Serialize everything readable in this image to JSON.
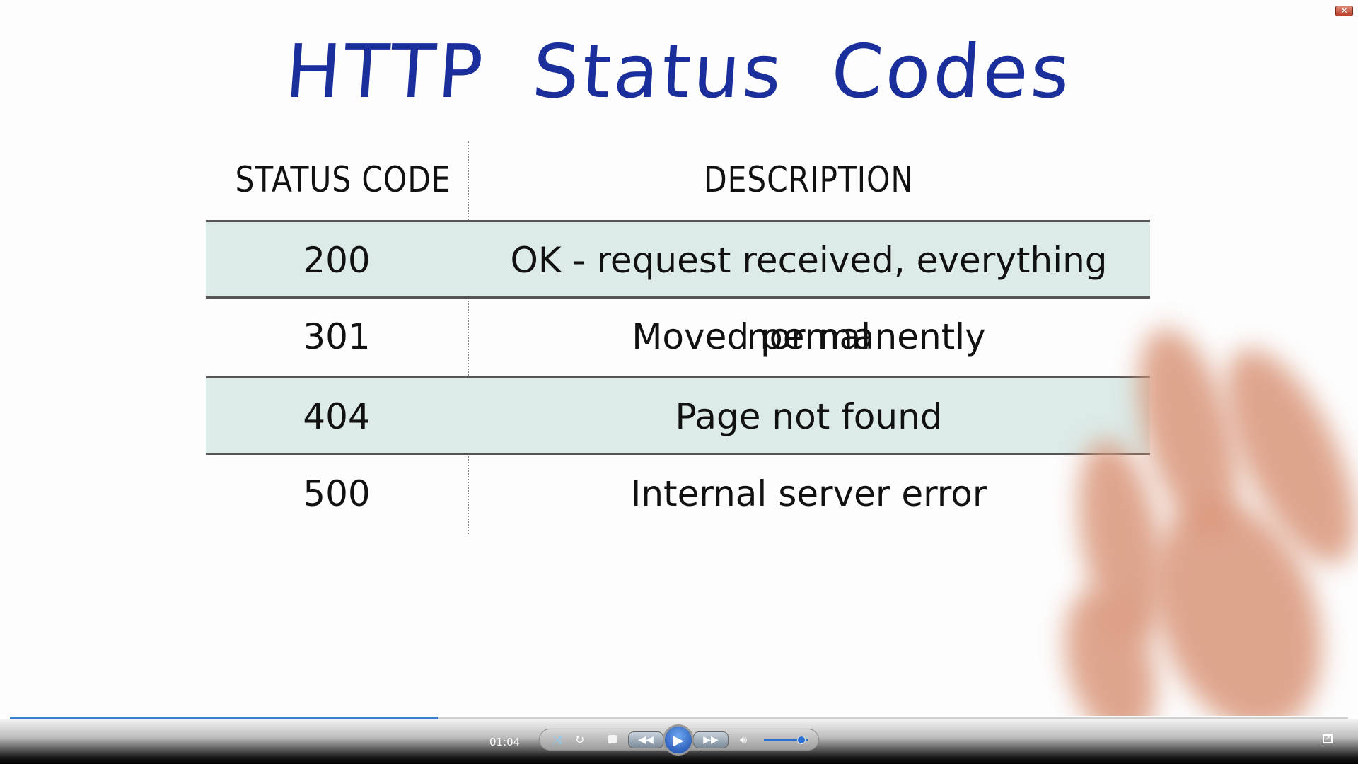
{
  "slide": {
    "title": "HTTP Status Codes",
    "headers": {
      "code": "STATUS CODE",
      "description": "DESCRIPTION"
    },
    "rows": [
      {
        "code": "200",
        "description": "OK - request received, everything normal"
      },
      {
        "code": "301",
        "description": "Moved permanently"
      },
      {
        "code": "404",
        "description": "Page not found"
      },
      {
        "code": "500",
        "description": "Internal server error"
      }
    ]
  },
  "player": {
    "time": "01:04",
    "progress_fraction": 0.32,
    "volume_fraction": 0.85,
    "icons": [
      "shuffle-icon",
      "repeat-icon",
      "stop-icon",
      "rewind-icon",
      "play-icon",
      "fast-forward-icon",
      "volume-icon",
      "fullscreen-icon",
      "close-icon"
    ]
  }
}
